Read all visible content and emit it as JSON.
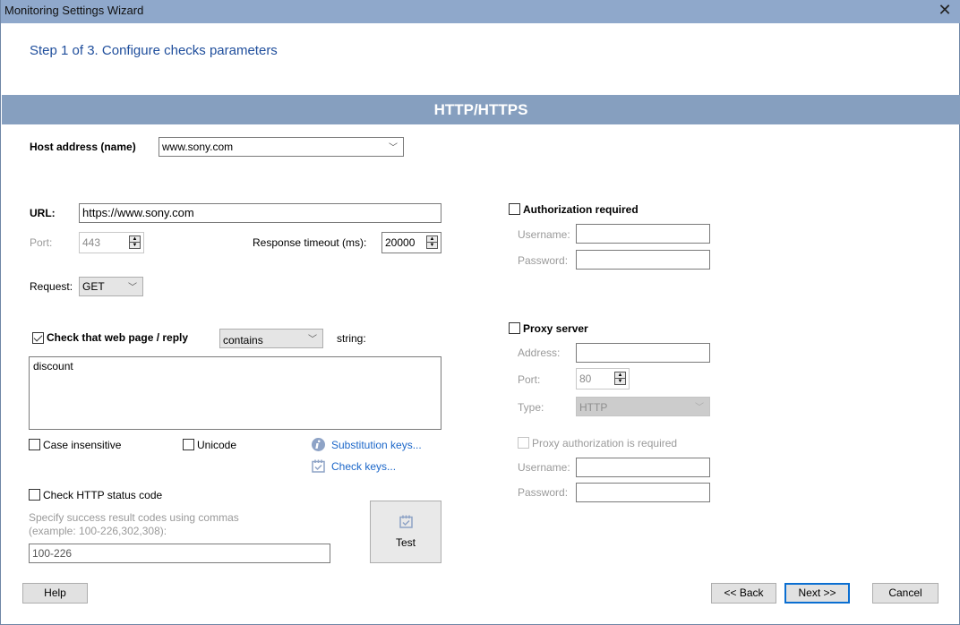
{
  "window": {
    "title": "Monitoring Settings Wizard",
    "close_icon": "close-icon"
  },
  "step_title": "Step 1 of 3. Configure checks parameters",
  "section_title": "HTTP/HTTPS",
  "host": {
    "label": "Host address (name)",
    "value": "www.sony.com"
  },
  "url": {
    "label": "URL:",
    "value": "https://www.sony.com"
  },
  "port": {
    "label": "Port:",
    "value": "443",
    "enabled": false
  },
  "response_timeout": {
    "label": "Response timeout (ms):",
    "value": "20000"
  },
  "request": {
    "label": "Request:",
    "value": "GET"
  },
  "content_check": {
    "label": "Check that web page / reply",
    "checked": true,
    "mode": "contains",
    "suffix_label": "string:",
    "text": "discount"
  },
  "case_insensitive": {
    "label": "Case insensitive",
    "checked": false
  },
  "unicode": {
    "label": "Unicode",
    "checked": false
  },
  "links": {
    "substitution_keys": "Substitution keys...",
    "check_keys": "Check keys..."
  },
  "status_code": {
    "label": "Check HTTP status code",
    "checked": false,
    "hint_line1": "Specify success result codes using commas",
    "hint_line2": "(example: 100-226,302,308):",
    "value": "100-226"
  },
  "test_button": {
    "label": "Test"
  },
  "authorization": {
    "label": "Authorization required",
    "checked": false,
    "username_label": "Username:",
    "username_value": "",
    "password_label": "Password:",
    "password_value": ""
  },
  "proxy": {
    "label": "Proxy server",
    "checked": false,
    "address_label": "Address:",
    "address_value": "",
    "port_label": "Port:",
    "port_value": "80",
    "type_label": "Type:",
    "type_value": "HTTP",
    "auth_label": "Proxy authorization is required",
    "auth_checked": false,
    "username_label": "Username:",
    "username_value": "",
    "password_label": "Password:",
    "password_value": ""
  },
  "footer": {
    "help": "Help",
    "back": "<< Back",
    "next": "Next >>",
    "cancel": "Cancel"
  },
  "colors": {
    "titlebar": "#8fa8cb",
    "section_band": "#869fbf",
    "step_title": "#1f4e9c",
    "link": "#1c67c9",
    "default_button_border": "#0a6ed1"
  }
}
